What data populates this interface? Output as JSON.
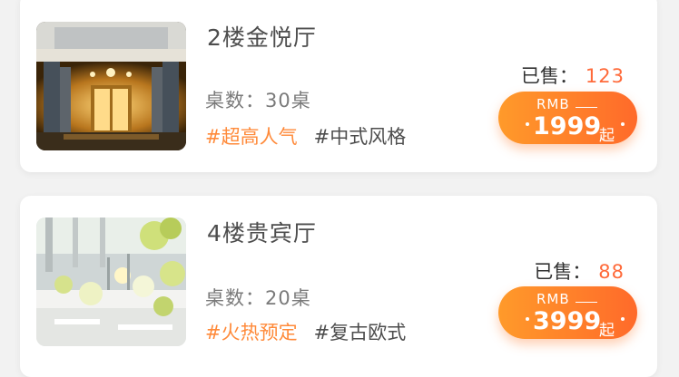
{
  "halls": [
    {
      "name": "2楼金悦厅",
      "tables": "桌数：30桌",
      "tags": [
        "#超高人气",
        "#中式风格"
      ],
      "sold_label": "已售：",
      "sold_count": "123",
      "currency": "RMB",
      "price": "1999",
      "price_suffix": "起",
      "image": "hotel-entrance-photo"
    },
    {
      "name": "4楼贵宾厅",
      "tables": "桌数：20桌",
      "tags": [
        "#火热预定",
        "#复古欧式"
      ],
      "sold_label": "已售：",
      "sold_count": "88",
      "currency": "RMB",
      "price": "3999",
      "price_suffix": "起",
      "image": "banquet-table-photo"
    }
  ],
  "colors": {
    "accent_tag": "#ff8a3a",
    "sold_number": "#ff6a3a",
    "button_gradient_start": "#ff9a2a",
    "button_gradient_end": "#ff6a2a"
  }
}
